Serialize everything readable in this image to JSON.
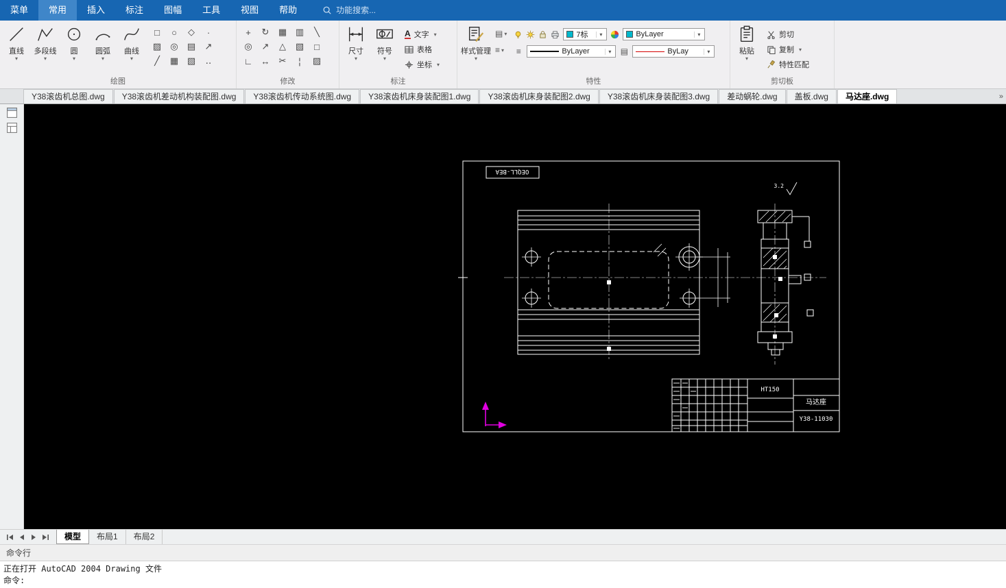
{
  "colors": {
    "menubar_bg": "#1766b2",
    "menubar_active_bg": "#3f86c9",
    "ribbon_bg": "#f0eff1",
    "canvas_bg": "#000000",
    "drawing_line": "#ffffff",
    "ucs_arrow": "#e100e1",
    "bylayer_cyan": "#00b8cc",
    "lineweight_red": "#d40000"
  },
  "menubar": {
    "items": [
      {
        "label": "菜单",
        "name": "menu-tab-menu"
      },
      {
        "label": "常用",
        "name": "menu-tab-home",
        "active": true
      },
      {
        "label": "插入",
        "name": "menu-tab-insert"
      },
      {
        "label": "标注",
        "name": "menu-tab-annotate"
      },
      {
        "label": "图幅",
        "name": "menu-tab-sheet"
      },
      {
        "label": "工具",
        "name": "menu-tab-tools"
      },
      {
        "label": "视图",
        "name": "menu-tab-view"
      },
      {
        "label": "帮助",
        "name": "menu-tab-help"
      }
    ],
    "search_placeholder": "功能搜索..."
  },
  "ribbon": {
    "draw": {
      "label": "绘图",
      "tools": {
        "line": "直线",
        "polyline": "多段线",
        "circle": "圆",
        "arc": "圆弧",
        "spline": "曲线"
      },
      "grid": [
        {
          "name": "rectangle-icon",
          "glyph": "□"
        },
        {
          "name": "ellipse-icon",
          "glyph": "○"
        },
        {
          "name": "polygon-icon",
          "glyph": "◇"
        },
        {
          "name": "point-icon",
          "glyph": "∙"
        },
        {
          "name": "hatch-icon",
          "glyph": "▨"
        },
        {
          "name": "donut-icon",
          "glyph": "◎"
        },
        {
          "name": "region-icon",
          "glyph": "▤"
        },
        {
          "name": "leader-icon",
          "glyph": "↗"
        },
        {
          "name": "construction-line-icon",
          "glyph": "╱"
        },
        {
          "name": "grid-fill-icon",
          "glyph": "▦"
        },
        {
          "name": "gradient-icon",
          "glyph": "▧"
        },
        {
          "name": "multipoint-icon",
          "glyph": "‥"
        }
      ]
    },
    "modify": {
      "label": "修改",
      "grid": [
        {
          "name": "move-icon",
          "glyph": "+"
        },
        {
          "name": "rotate-icon",
          "glyph": "↻"
        },
        {
          "name": "array-icon",
          "glyph": "▦"
        },
        {
          "name": "copy-object-icon",
          "glyph": "▥"
        },
        {
          "name": "erase-icon",
          "glyph": "╲"
        },
        {
          "name": "offset-icon",
          "glyph": "◎"
        },
        {
          "name": "scale-icon",
          "glyph": "↗"
        },
        {
          "name": "mirror-icon",
          "glyph": "△"
        },
        {
          "name": "hatch-edit-icon",
          "glyph": "▧"
        },
        {
          "name": "explode-icon",
          "glyph": "□"
        },
        {
          "name": "fillet-icon",
          "glyph": "∟"
        },
        {
          "name": "stretch-icon",
          "glyph": "↔"
        },
        {
          "name": "trim-icon",
          "glyph": "✂"
        },
        {
          "name": "break-icon",
          "glyph": "¦"
        },
        {
          "name": "join-icon",
          "glyph": "▨"
        }
      ]
    },
    "annotate": {
      "label": "标注",
      "dimension": "尺寸",
      "symbol": "符号",
      "text": "文字",
      "table": "表格",
      "coordinate": "坐标"
    },
    "properties": {
      "label": "特性",
      "style_manager": "样式管理",
      "layer": "7标",
      "color": "ByLayer",
      "linetype": "ByLayer",
      "lineweight": "ByLay"
    },
    "clipboard": {
      "label": "剪切板",
      "paste": "粘贴",
      "cut": "剪切",
      "copy": "复制",
      "match_properties": "特性匹配"
    }
  },
  "doc_tabs": [
    {
      "label": "Y38滚齿机总图.dwg",
      "name": "doc-tab-y38-general"
    },
    {
      "label": "Y38滚齿机差动机构装配图.dwg",
      "name": "doc-tab-differential-assembly"
    },
    {
      "label": "Y38滚齿机传动系统图.dwg",
      "name": "doc-tab-transmission-system"
    },
    {
      "label": "Y38滚齿机床身装配图1.dwg",
      "name": "doc-tab-bed-assembly-1"
    },
    {
      "label": "Y38滚齿机床身装配图2.dwg",
      "name": "doc-tab-bed-assembly-2"
    },
    {
      "label": "Y38滚齿机床身装配图3.dwg",
      "name": "doc-tab-bed-assembly-3"
    },
    {
      "label": "差动蜗轮.dwg",
      "name": "doc-tab-differential-worm-gear"
    },
    {
      "label": "盖板.dwg",
      "name": "doc-tab-cover-plate"
    },
    {
      "label": "马达座.dwg",
      "name": "doc-tab-motor-seat",
      "active": true
    }
  ],
  "drawing": {
    "frame_label": "OEQLL-BEA",
    "roughness": "3.2",
    "title_block": {
      "material": "HT150",
      "part_name": "马达座",
      "drawing_number": "Y38-11030"
    }
  },
  "layout_tabs": [
    {
      "label": "模型",
      "name": "layout-tab-model",
      "active": true
    },
    {
      "label": "布局1",
      "name": "layout-tab-1"
    },
    {
      "label": "布局2",
      "name": "layout-tab-2"
    }
  ],
  "command": {
    "title": "命令行",
    "lines": [
      "正在打开 AutoCAD 2004 Drawing 文件",
      "命令:"
    ]
  },
  "icons": {
    "caret": "▾",
    "text_tool": "A",
    "annotation_scale": "▤",
    "list": "≡",
    "overflow": "»"
  }
}
